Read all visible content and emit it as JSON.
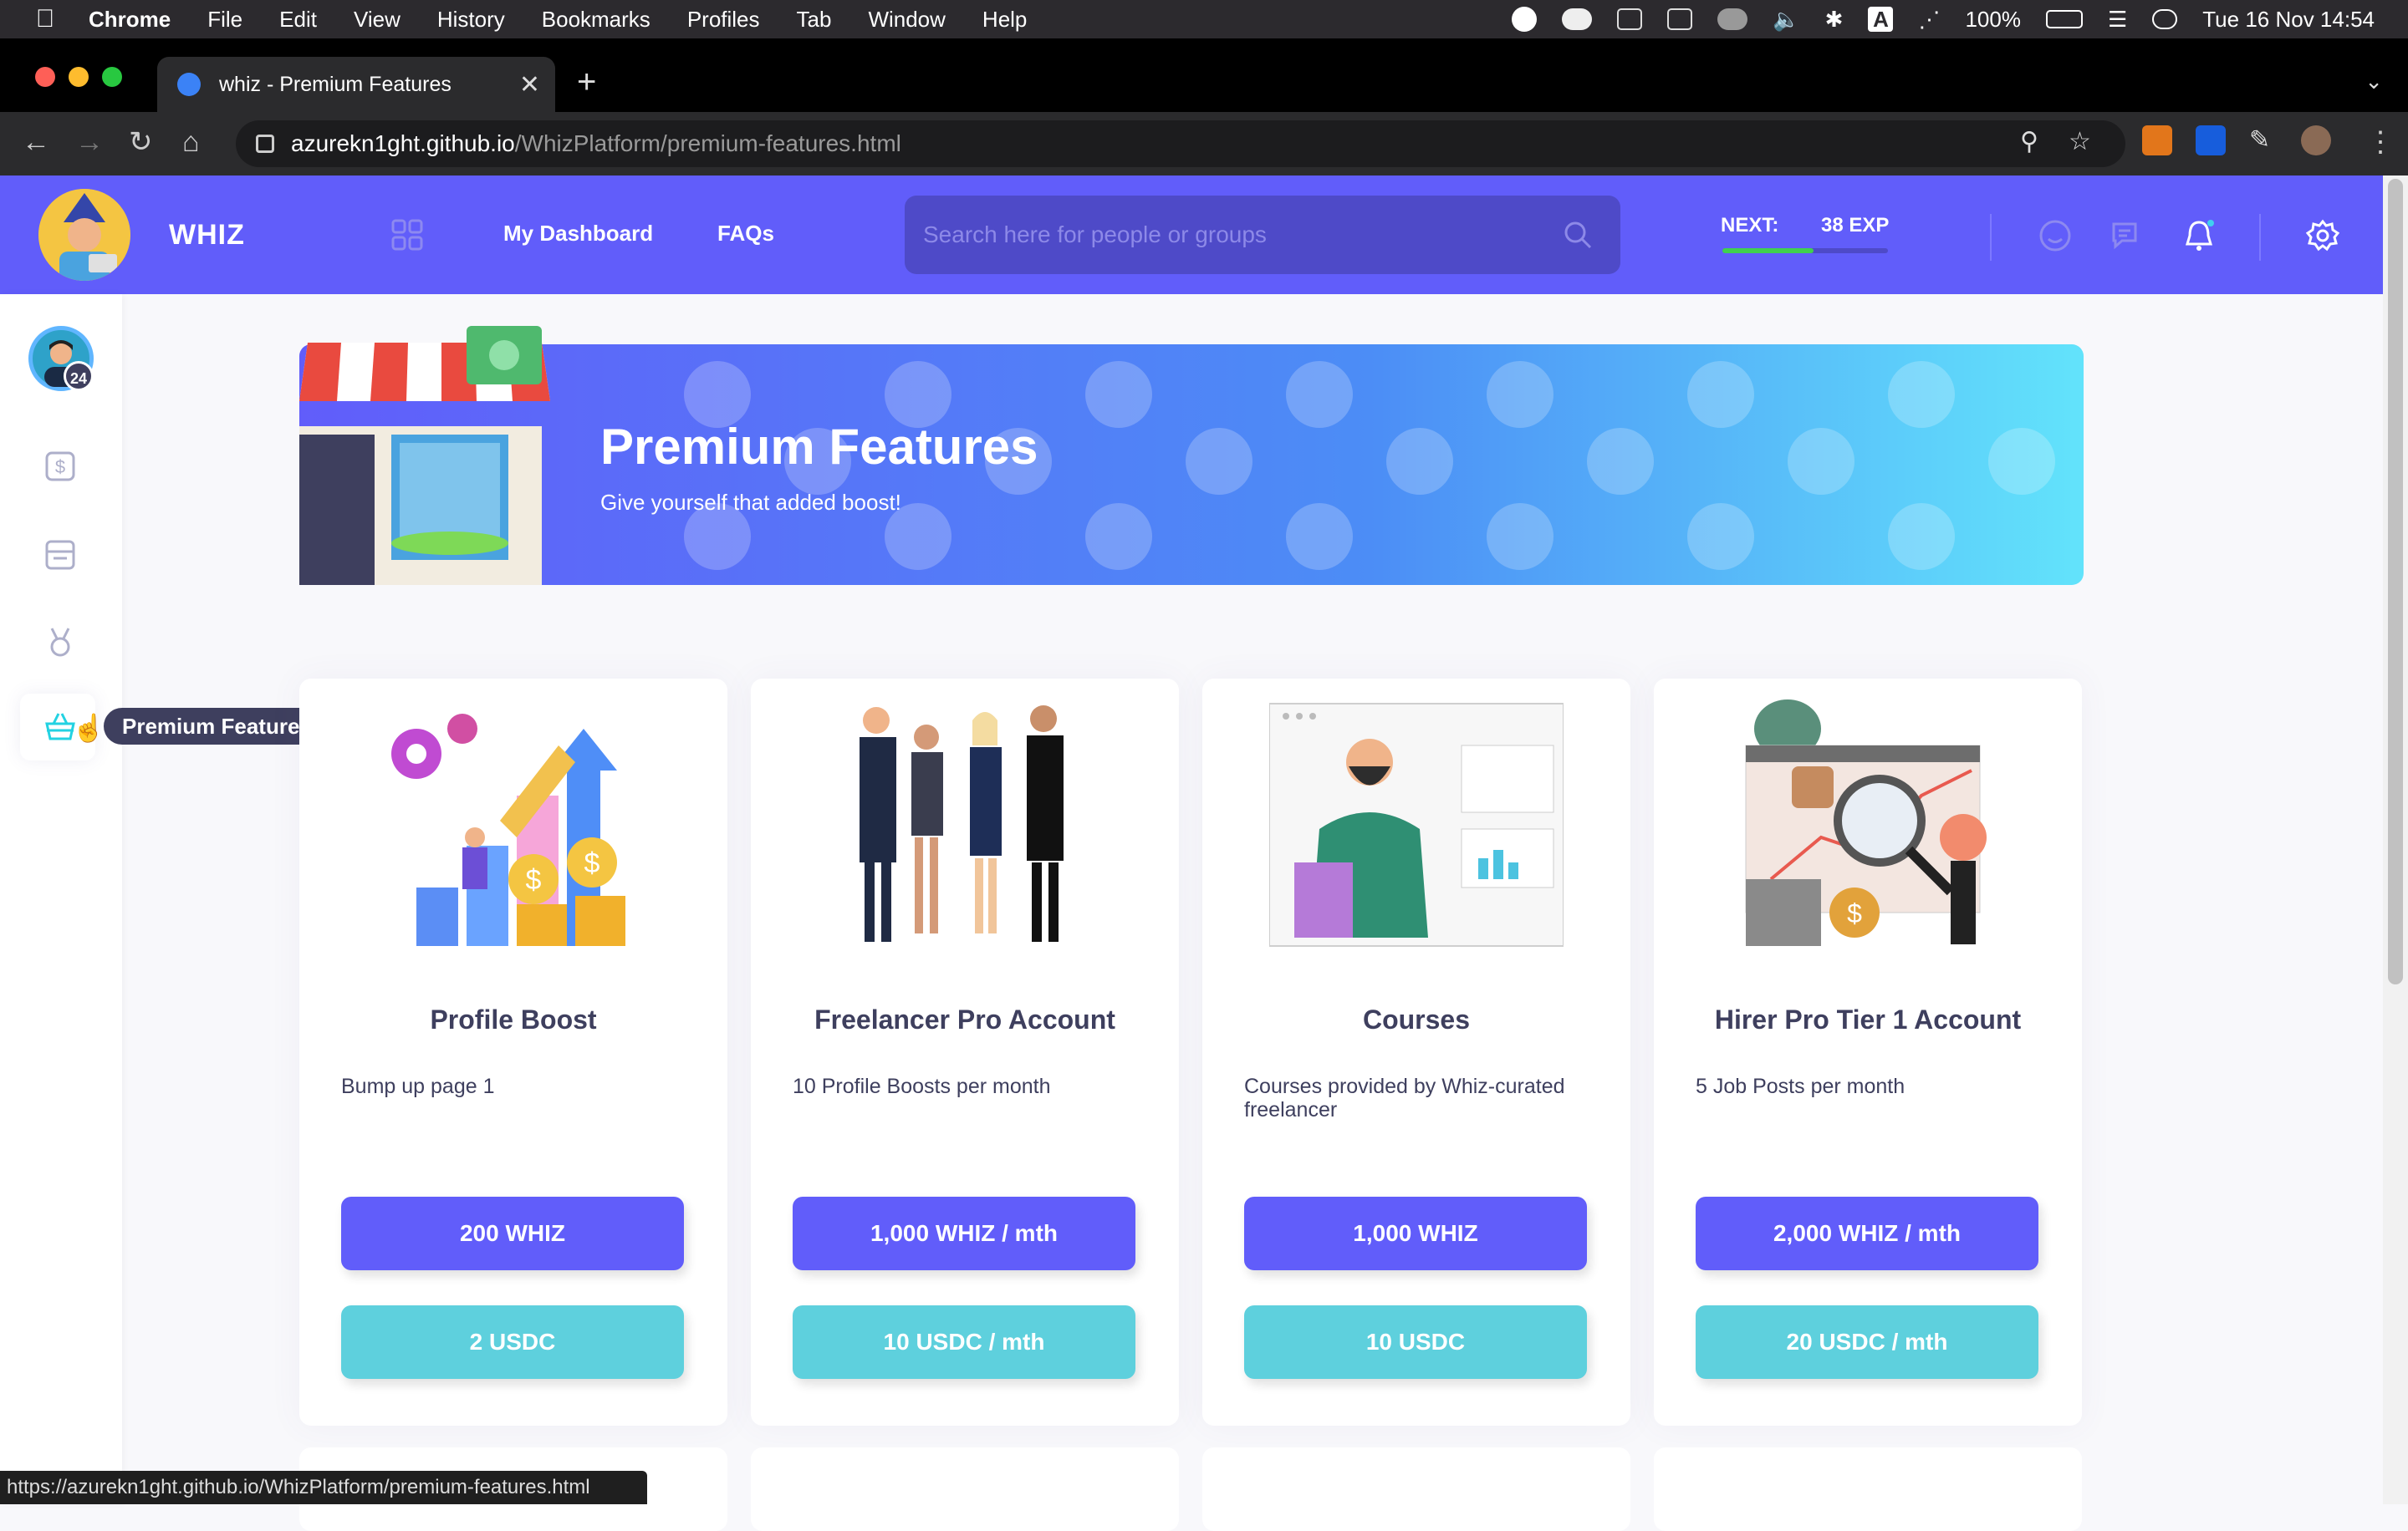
{
  "macos_menu": {
    "app": "Chrome",
    "items": [
      "File",
      "Edit",
      "View",
      "History",
      "Bookmarks",
      "Profiles",
      "Tab",
      "Window",
      "Help"
    ],
    "battery": "100%",
    "clock": "Tue 16 Nov  14:54"
  },
  "browser": {
    "tab_title": "whiz - Premium Features",
    "url_host": "azurekn1ght.github.io",
    "url_path": "/WhizPlatform/premium-features.html",
    "status_url": "https://azurekn1ght.github.io/WhizPlatform/premium-features.html"
  },
  "header": {
    "logo": "WHIZ",
    "nav": [
      "My Dashboard",
      "FAQs"
    ],
    "search_placeholder": "Search here for people or groups",
    "next_label": "NEXT:",
    "next_value": "38 EXP",
    "exp_progress": 0.55
  },
  "sidebar": {
    "avatar_level": "24",
    "tooltip": "Premium Features"
  },
  "banner": {
    "title": "Premium Features",
    "subtitle": "Give yourself that added boost!"
  },
  "cards": [
    {
      "title": "Profile Boost",
      "desc": "Bump up page 1",
      "price_primary": "200 WHIZ",
      "price_secondary": "2 USDC"
    },
    {
      "title": "Freelancer Pro Account",
      "desc": "10 Profile Boosts per month",
      "price_primary": "1,000 WHIZ / mth",
      "price_secondary": "10 USDC / mth"
    },
    {
      "title": "Courses",
      "desc": "Courses provided by Whiz-curated freelancer",
      "price_primary": "1,000 WHIZ",
      "price_secondary": "10 USDC"
    },
    {
      "title": "Hirer Pro Tier 1 Account",
      "desc": "5 Job Posts per month",
      "price_primary": "2,000 WHIZ / mth",
      "price_secondary": "20 USDC / mth"
    }
  ],
  "colors": {
    "brand": "#615dfa",
    "secondary": "#5ed0dd",
    "text": "#3e3f5e"
  }
}
